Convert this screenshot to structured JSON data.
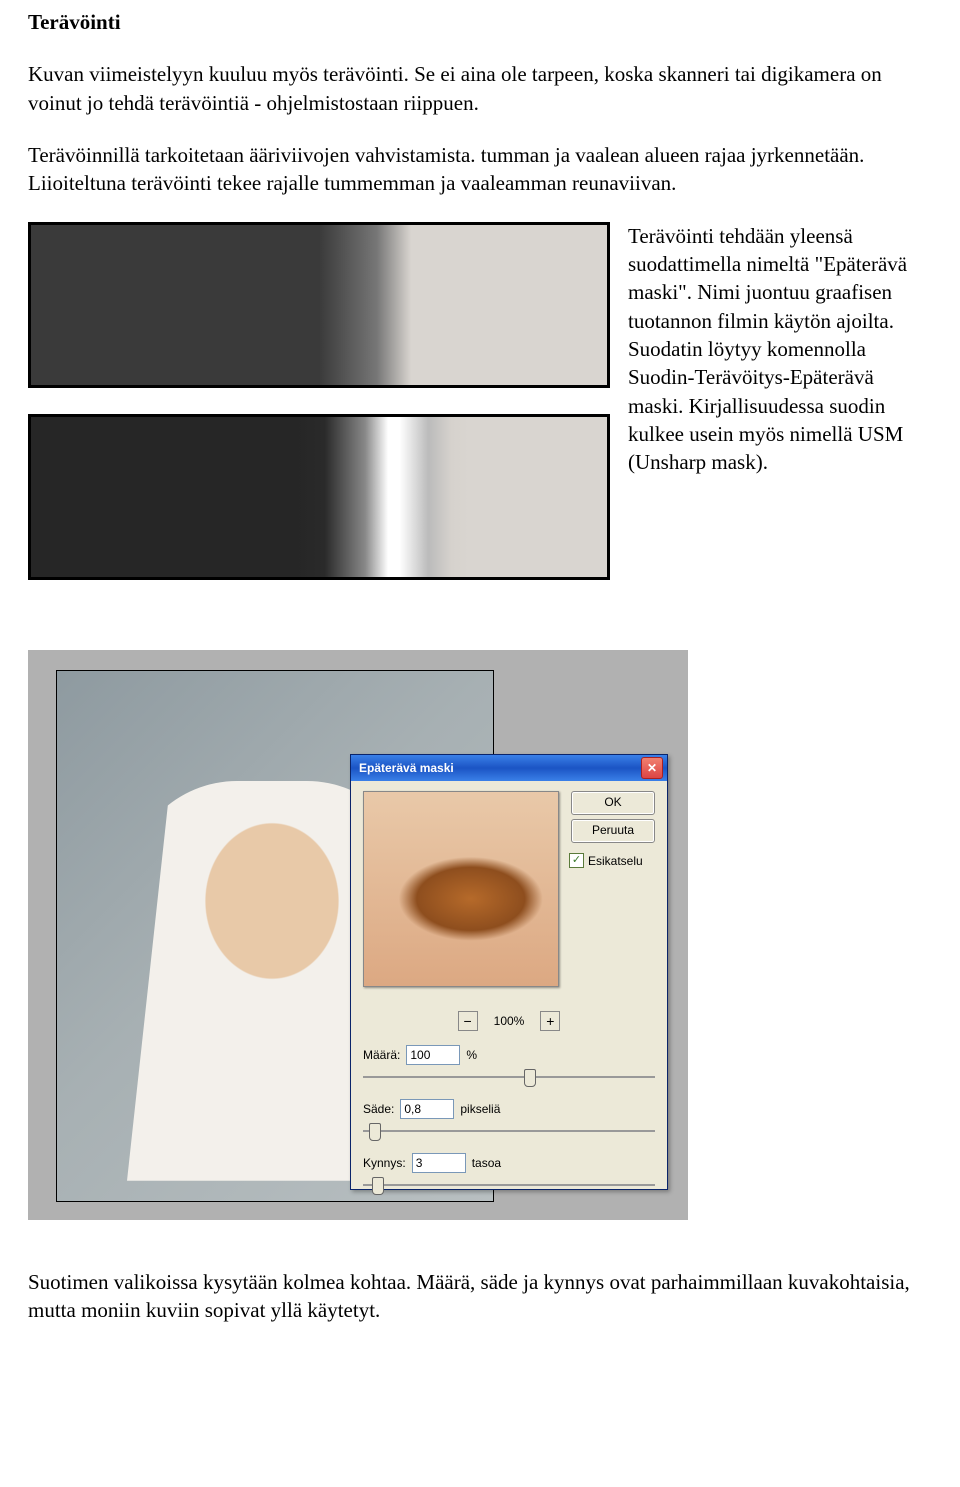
{
  "title": "Terävöinti",
  "para1": "Kuvan viimeistelyyn kuuluu myös terävöinti. Se ei aina ole tarpeen, koska skanneri tai digikamera on voinut jo tehdä terävöintiä - ohjelmistostaan riippuen.",
  "para2": "Terävöinnillä tarkoitetaan ääriviivojen vahvistamista. tumman ja vaalean alueen rajaa jyrkennetään. Liioiteltuna terävöinti tekee rajalle tummemman ja vaaleamman reunaviivan.",
  "side": "Terävöinti tehdään yleensä suodattimella nimeltä \"Epäterävä maski\". Nimi juontuu graafisen tuotannon filmin käytön ajoilta. Suodatin löytyy komennolla Suodin-Terävöitys-Epäterävä maski. Kirjallisuudessa suodin kulkee usein myös nimellä USM (Unsharp mask).",
  "dialog": {
    "title": "Epäterävä maski",
    "ok": "OK",
    "cancel": "Peruuta",
    "preview_label": "Esikatselu",
    "zoom_minus": "−",
    "zoom_pct": "100%",
    "zoom_plus": "+",
    "amount_label": "Määrä:",
    "amount_value": "100",
    "amount_unit": "%",
    "radius_label": "Säde:",
    "radius_value": "0,8",
    "radius_unit": "pikseliä",
    "threshold_label": "Kynnys:",
    "threshold_value": "3",
    "threshold_unit": "tasoa"
  },
  "footer": "Suotimen valikoissa kysytään kolmea kohtaa. Määrä, säde ja kynnys ovat parhaimmillaan kuvakohtaisia, mutta moniin kuviin sopivat yllä käytetyt."
}
